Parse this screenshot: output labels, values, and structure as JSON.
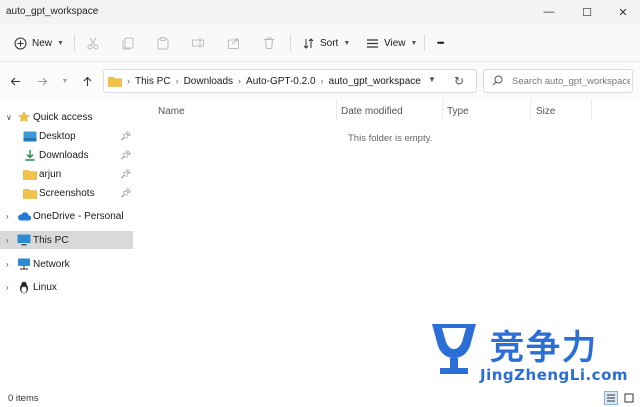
{
  "window": {
    "title": "auto_gpt_workspace",
    "minimize_glyph": "—",
    "maximize_glyph": "☐",
    "close_glyph": "✕"
  },
  "toolbar": {
    "new_label": "New",
    "sort_label": "Sort",
    "view_label": "View",
    "more_glyph": "•••",
    "icons": [
      "new-plus-icon",
      "cut-icon",
      "copy-icon",
      "paste-icon",
      "rename-icon",
      "share-icon",
      "delete-icon",
      "sort-icon",
      "view-icon",
      "more-icon"
    ]
  },
  "address": {
    "crumbs": [
      "This PC",
      "Downloads",
      "Auto-GPT-0.2.0",
      "auto_gpt_workspace"
    ]
  },
  "search": {
    "placeholder": "Search auto_gpt_workspace"
  },
  "sidebar": {
    "quick_access": {
      "label": "Quick access",
      "items": [
        {
          "label": "Desktop",
          "icon": "desktop-folder-icon",
          "pinned": true
        },
        {
          "label": "Downloads",
          "icon": "downloads-icon",
          "pinned": true
        },
        {
          "label": "arjun",
          "icon": "folder-icon",
          "pinned": true
        },
        {
          "label": "Screenshots",
          "icon": "folder-icon",
          "pinned": true
        }
      ]
    },
    "onedrive": "OneDrive - Personal",
    "this_pc": "This PC",
    "network": "Network",
    "linux": "Linux"
  },
  "file_list": {
    "columns": [
      "Name",
      "Date modified",
      "Type",
      "Size"
    ],
    "empty_message": "This folder is empty."
  },
  "status": {
    "items_text": "0 items",
    "view_mode": "details"
  },
  "watermark": {
    "text": "竞争力",
    "domain": "JingZhengLi.com"
  },
  "colors": {
    "accent": "#2b6fd6",
    "folder": "#f3c348",
    "selection": "#d9d9d9"
  }
}
